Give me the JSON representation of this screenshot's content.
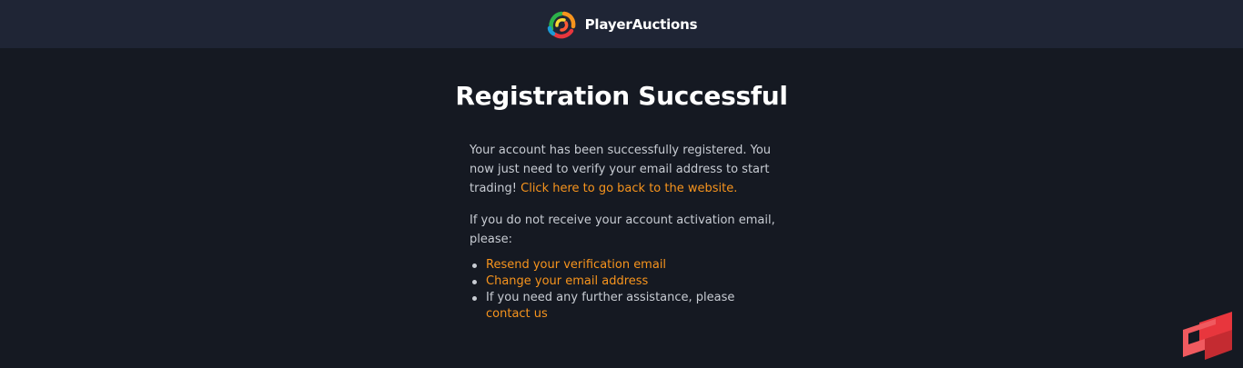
{
  "header": {
    "brand_name": "PlayerAuctions",
    "logo_icon": "playerauctions-logo-icon"
  },
  "main": {
    "title": "Registration Successful",
    "intro_text": "Your account has been successfully registered. You now just need to verify your email address to start trading!",
    "back_link": "Click here to go back to the website.",
    "instruction_text": "If you do not receive your account activation email, please:",
    "actions": {
      "resend_link": "Resend your verification email",
      "change_email_link": "Change your email address",
      "assistance_text": "If you need any further assistance, please",
      "contact_link": "contact us"
    }
  },
  "corner_widget": {
    "icon": "support-widget-icon"
  },
  "colors": {
    "header_bg": "#1f2535",
    "page_bg": "#151922",
    "text": "#c8ccd3",
    "title": "#ffffff",
    "link": "#f7941d",
    "widget": "#e8363d"
  }
}
